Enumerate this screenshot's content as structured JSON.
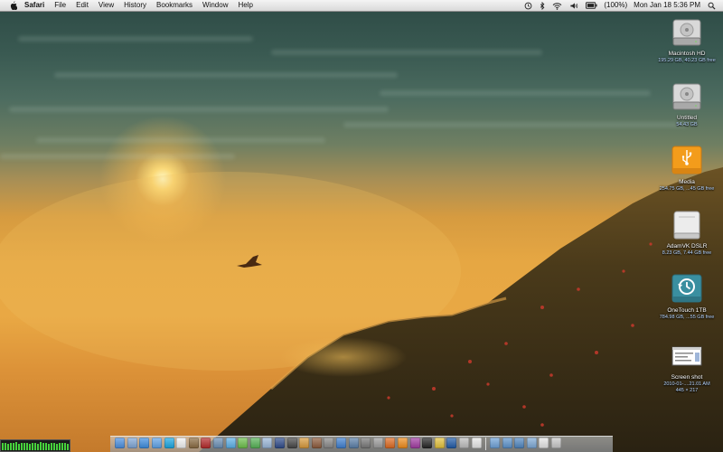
{
  "menubar": {
    "app_name": "Safari",
    "menus": [
      "File",
      "Edit",
      "View",
      "History",
      "Bookmarks",
      "Window",
      "Help"
    ],
    "battery_percent": "(100%)",
    "clock": "Mon Jan 18  5:36 PM",
    "extras": [
      "time-machine-icon",
      "bluetooth-icon",
      "wifi-icon",
      "volume-icon",
      "battery-icon",
      "spotlight-icon"
    ]
  },
  "desktop_icons": [
    {
      "name": "Macintosh HD",
      "info": "195.29 GB, 40.23 GB free",
      "icon": "hard-drive-icon"
    },
    {
      "name": "Untitled",
      "info": "54.43 GB",
      "icon": "hard-drive-icon"
    },
    {
      "name": "Media",
      "info": "254.75 GB, ...45 GB free",
      "icon": "usb-drive-icon"
    },
    {
      "name": "AdamVK DSLR",
      "info": "8.23 GB, 7.44 GB free",
      "icon": "external-drive-icon"
    },
    {
      "name": "OneTouch 1TB",
      "info": "784.98 GB, ...55 GB free",
      "icon": "time-machine-drive-icon"
    },
    {
      "name": "Screen shot",
      "info": "2010-01-....21.01 AM",
      "info2": "445 × 217",
      "icon": "screenshot-file-icon"
    }
  ],
  "dock": {
    "apps": [
      {
        "name": "finder",
        "color": "#4a8fe0"
      },
      {
        "name": "mail",
        "color": "#7fa6d6"
      },
      {
        "name": "safari",
        "color": "#3c8de0"
      },
      {
        "name": "ichat",
        "color": "#5fa3e8"
      },
      {
        "name": "skype",
        "color": "#19a7e3"
      },
      {
        "name": "ical",
        "color": "#f2f2f2"
      },
      {
        "name": "address-book",
        "color": "#8a6a3f"
      },
      {
        "name": "photo-booth",
        "color": "#b52828"
      },
      {
        "name": "iphoto",
        "color": "#6a8fb5"
      },
      {
        "name": "itunes",
        "color": "#5bb0e8"
      },
      {
        "name": "messages",
        "color": "#6cc04a"
      },
      {
        "name": "adium",
        "color": "#55b355"
      },
      {
        "name": "preview",
        "color": "#9ab7d9"
      },
      {
        "name": "photoshop",
        "color": "#2d4a8a"
      },
      {
        "name": "aperture",
        "color": "#444444"
      },
      {
        "name": "terminal-editor",
        "color": "#d99a3a"
      },
      {
        "name": "dictionary",
        "color": "#8d5a3a"
      },
      {
        "name": "system-preferences",
        "color": "#888888"
      },
      {
        "name": "app-store",
        "color": "#3d7fd1"
      },
      {
        "name": "xcode",
        "color": "#5a7fa8"
      },
      {
        "name": "camera",
        "color": "#777777"
      },
      {
        "name": "utility",
        "color": "#9c9c9c"
      },
      {
        "name": "firefox",
        "color": "#e06a1f"
      },
      {
        "name": "vlc",
        "color": "#f08c1a"
      },
      {
        "name": "textmate",
        "color": "#a23aa2"
      },
      {
        "name": "activity",
        "color": "#222222"
      },
      {
        "name": "chrome",
        "color": "#e4c23a"
      },
      {
        "name": "quicktime",
        "color": "#1e5aa8"
      },
      {
        "name": "disk-utility",
        "color": "#bdbdbd"
      },
      {
        "name": "textedit",
        "color": "#e8e8e8"
      }
    ],
    "stacks": [
      {
        "name": "applications-stack",
        "color": "#6ea2d8"
      },
      {
        "name": "documents-stack",
        "color": "#5c93cc"
      },
      {
        "name": "downloads-stack",
        "color": "#4f86c0"
      },
      {
        "name": "pictures-stack",
        "color": "#7da9d6"
      },
      {
        "name": "file-stack",
        "color": "#e6e6e6"
      },
      {
        "name": "trash",
        "color": "#c8c8c8"
      }
    ]
  },
  "activity_meter": {
    "levels": [
      0.75,
      0.8,
      0.7,
      0.8,
      0.75,
      0.85,
      0.7,
      0.8,
      0.75,
      0.8,
      0.7,
      0.75,
      0.8,
      0.7,
      0.85,
      0.75,
      0.8,
      0.7,
      0.75,
      0.8,
      0.7,
      0.75,
      0.8,
      0.75,
      0.7
    ]
  },
  "colors": {
    "meter_green": "#46d23c",
    "drive_silver": "#d9d9d9",
    "usb_orange": "#f39c1b",
    "tm_teal": "#3a8fa0"
  }
}
